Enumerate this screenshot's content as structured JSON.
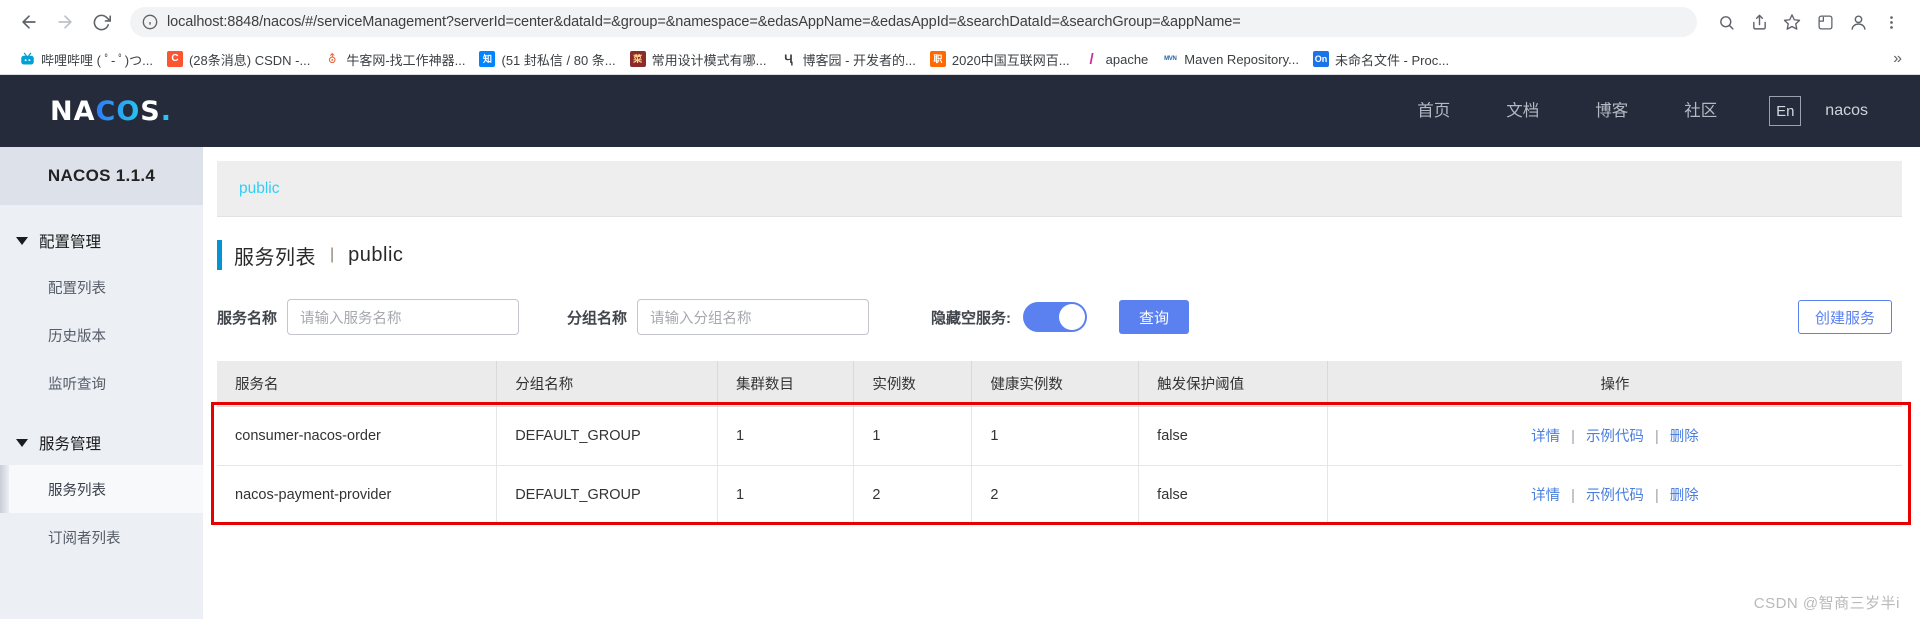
{
  "browser": {
    "url": "localhost:8848/nacos/#/serviceManagement?serverId=center&dataId=&group=&namespace=&edasAppName=&edasAppId=&searchDataId=&searchGroup=&appName=",
    "back_icon": "back-arrow-icon",
    "forward_icon": "forward-arrow-icon",
    "reload_icon": "reload-icon",
    "site_info_icon": "site-info-icon",
    "zoom_icon": "zoom-icon",
    "share_icon": "share-icon",
    "bookmark_icon": "star-icon",
    "extensions_icon": "extensions-icon",
    "profile_icon": "profile-avatar-icon",
    "menu_icon": "three-dot-menu-icon",
    "overflow_label": "»",
    "bookmarks": [
      {
        "label": "哔哩哔哩 ( ﾟ- ﾟ)つ...",
        "icon_text": "B",
        "icon_bg": "#ffffff",
        "icon_fg": "#00a1d6"
      },
      {
        "label": "(28条消息) CSDN -...",
        "icon_text": "C",
        "icon_bg": "#fc5531",
        "icon_fg": "#ffffff"
      },
      {
        "label": "牛客网-找工作神器...",
        "icon_text": "牛",
        "icon_bg": "#ffffff",
        "icon_fg": "#e8663d"
      },
      {
        "label": "(51 封私信 / 80 条...",
        "icon_text": "知",
        "icon_bg": "#0084ff",
        "icon_fg": "#ffffff"
      },
      {
        "label": "常用设计模式有哪...",
        "icon_text": "菜",
        "icon_bg": "#8b2b2b",
        "icon_fg": "#ffdd88"
      },
      {
        "label": "博客园 - 开发者的...",
        "icon_text": "Ƕ",
        "icon_bg": "#ffffff",
        "icon_fg": "#3c4043"
      },
      {
        "label": "2020中国互联网百...",
        "icon_text": "职",
        "icon_bg": "#ff6a00",
        "icon_fg": "#ffffff"
      },
      {
        "label": "apache",
        "icon_text": "/",
        "icon_bg": "#ffffff",
        "icon_fg": "#d0289c"
      },
      {
        "label": "Maven Repository...",
        "icon_text": "MVN",
        "icon_bg": "#ffffff",
        "icon_fg": "#1f5fa8"
      },
      {
        "label": "未命名文件 - Proc...",
        "icon_text": "On",
        "icon_bg": "#1a73e8",
        "icon_fg": "#ffffff"
      }
    ]
  },
  "header": {
    "logo_white_1": "NA",
    "logo_gradient": "CO",
    "logo_white_2": "S",
    "logo_dot": ".",
    "nav": [
      {
        "label": "首页"
      },
      {
        "label": "文档"
      },
      {
        "label": "博客"
      },
      {
        "label": "社区"
      }
    ],
    "lang_toggle": "En",
    "user": "nacos"
  },
  "sidebar": {
    "title": "NACOS 1.1.4",
    "groups": [
      {
        "label": "配置管理",
        "items": [
          {
            "label": "配置列表",
            "active": false
          },
          {
            "label": "历史版本",
            "active": false
          },
          {
            "label": "监听查询",
            "active": false
          }
        ]
      },
      {
        "label": "服务管理",
        "items": [
          {
            "label": "服务列表",
            "active": true
          },
          {
            "label": "订阅者列表",
            "active": false
          }
        ]
      }
    ]
  },
  "main": {
    "breadcrumb": "public",
    "page_title": "服务列表",
    "page_title_sep": "|",
    "page_title_namespace": "public",
    "filters": {
      "service_label": "服务名称",
      "service_placeholder": "请输入服务名称",
      "service_value": "",
      "group_label": "分组名称",
      "group_placeholder": "请输入分组名称",
      "group_value": "",
      "hide_empty_label": "隐藏空服务:",
      "hide_empty_on": true,
      "query_button": "查询",
      "create_button": "创建服务"
    },
    "table": {
      "columns": [
        "服务名",
        "分组名称",
        "集群数目",
        "实例数",
        "健康实例数",
        "触发保护阈值",
        "操作"
      ],
      "rows": [
        {
          "service_name": "consumer-nacos-order",
          "group_name": "DEFAULT_GROUP",
          "cluster_count": "1",
          "instance_count": "1",
          "healthy_instance_count": "1",
          "threshold": "false",
          "actions": [
            "详情",
            "示例代码",
            "删除"
          ]
        },
        {
          "service_name": "nacos-payment-provider",
          "group_name": "DEFAULT_GROUP",
          "cluster_count": "1",
          "instance_count": "2",
          "healthy_instance_count": "2",
          "threshold": "false",
          "actions": [
            "详情",
            "示例代码",
            "删除"
          ]
        }
      ],
      "action_separator": "|"
    },
    "highlight_color": "#e60000",
    "watermark": "CSDN @智商三岁半i"
  },
  "colors": {
    "header_bg": "#252b3a",
    "accent_blue": "#5b81f0",
    "link_cyan": "#33cdf5",
    "title_bar": "#0593d3",
    "annotation_red": "#e60000"
  }
}
